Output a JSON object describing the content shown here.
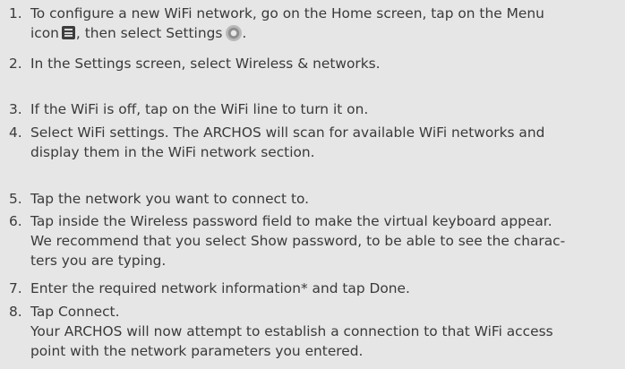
{
  "steps": [
    {
      "number": "1.",
      "lines": [
        {
          "text": "To configure a new WiFi network, go on the Home screen, tap on the Menu"
        },
        {
          "pre": "icon",
          "menu_icon": "menu-icon",
          "mid": ", then select Settings",
          "settings_icon": "gear-icon",
          "post": "."
        }
      ]
    },
    {
      "number": "2.",
      "lines": [
        {
          "text": "In the Settings screen, select Wireless & networks."
        }
      ]
    },
    {
      "number": "3.",
      "lines": [
        {
          "text": "If the WiFi is off, tap on the WiFi line to turn it on."
        }
      ]
    },
    {
      "number": "4.",
      "lines": [
        {
          "text": "Select WiFi settings. The ARCHOS will scan for available WiFi networks and"
        },
        {
          "text": "display them in the WiFi network section."
        }
      ]
    },
    {
      "number": "5.",
      "lines": [
        {
          "text": "Tap the network you want to connect to."
        }
      ]
    },
    {
      "number": "6.",
      "lines": [
        {
          "text": "Tap inside the Wireless password field to make the virtual keyboard appear."
        },
        {
          "text": "We recommend that you select Show password, to be able to see the charac-"
        },
        {
          "text": "ters you are typing."
        }
      ]
    },
    {
      "number": "7.",
      "lines": [
        {
          "text": "Enter the required network information* and tap Done."
        }
      ]
    },
    {
      "number": "8.",
      "lines": [
        {
          "text": "Tap Connect."
        },
        {
          "text": "Your ARCHOS will now attempt to establish a connection to that WiFi access"
        },
        {
          "text": "point with the network parameters you entered."
        }
      ]
    }
  ],
  "colors": {
    "background": "#e6e6e6",
    "text": "#3a3a3a"
  }
}
